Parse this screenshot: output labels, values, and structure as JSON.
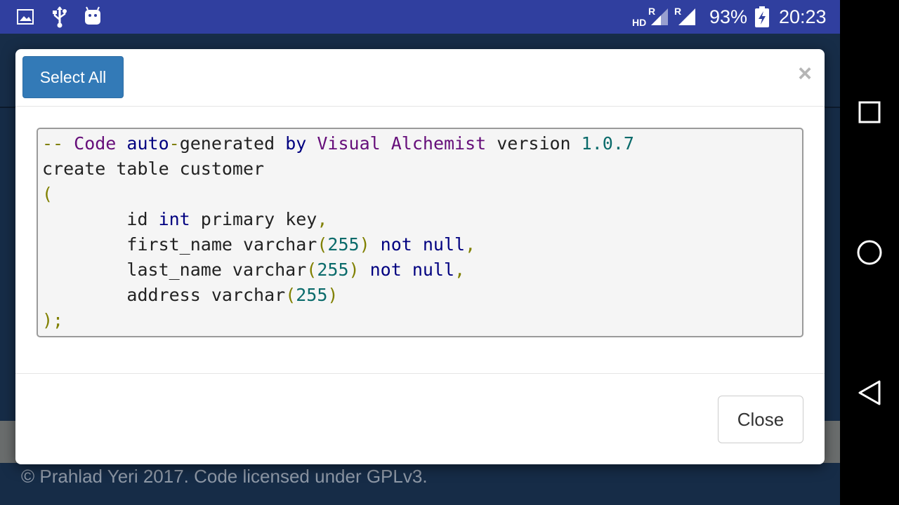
{
  "status_bar": {
    "battery_percent": "93%",
    "time": "20:23",
    "hd_label": "HD",
    "roaming_label_1": "R",
    "roaming_label_2": "R",
    "icons": [
      "image-icon",
      "usb-icon",
      "android-debug-icon",
      "signal-icon",
      "battery-charging-icon"
    ]
  },
  "dialog": {
    "select_all_label": "Select All",
    "close_x": "×",
    "close_button_label": "Close",
    "code_lines": [
      [
        {
          "t": "-- ",
          "c": "punct"
        },
        {
          "t": "Code ",
          "c": "cm"
        },
        {
          "t": "auto",
          "c": "kw"
        },
        {
          "t": "-",
          "c": "punct"
        },
        {
          "t": "generated ",
          "c": "plain"
        },
        {
          "t": "by ",
          "c": "kw"
        },
        {
          "t": "Visual Alchemist ",
          "c": "cm"
        },
        {
          "t": "version ",
          "c": "plain"
        },
        {
          "t": "1.0.7",
          "c": "num"
        }
      ],
      [
        {
          "t": "create table customer",
          "c": "plain"
        }
      ],
      [
        {
          "t": "(",
          "c": "punct"
        }
      ],
      [
        {
          "t": "        id ",
          "c": "plain"
        },
        {
          "t": "int ",
          "c": "kw"
        },
        {
          "t": "primary key",
          "c": "plain"
        },
        {
          "t": ",",
          "c": "punct"
        }
      ],
      [
        {
          "t": "        first_name varchar",
          "c": "plain"
        },
        {
          "t": "(",
          "c": "punct"
        },
        {
          "t": "255",
          "c": "num"
        },
        {
          "t": ") ",
          "c": "punct"
        },
        {
          "t": "not null",
          "c": "kw"
        },
        {
          "t": ",",
          "c": "punct"
        }
      ],
      [
        {
          "t": "        last_name varchar",
          "c": "plain"
        },
        {
          "t": "(",
          "c": "punct"
        },
        {
          "t": "255",
          "c": "num"
        },
        {
          "t": ") ",
          "c": "punct"
        },
        {
          "t": "not null",
          "c": "kw"
        },
        {
          "t": ",",
          "c": "punct"
        }
      ],
      [
        {
          "t": "        address varchar",
          "c": "plain"
        },
        {
          "t": "(",
          "c": "punct"
        },
        {
          "t": "255",
          "c": "num"
        },
        {
          "t": ")",
          "c": "punct"
        }
      ],
      [
        {
          "t": ");",
          "c": "punct"
        }
      ]
    ]
  },
  "footer": {
    "text": "© Prahlad Yeri 2017. Code licensed under GPLv3."
  },
  "nav_bar": {
    "icons": [
      "recents-square-icon",
      "home-circle-icon",
      "back-triangle-icon"
    ]
  },
  "colors": {
    "status_bar_bg": "#303f9f",
    "primary_button": "#337ab7",
    "app_background": "#162c47"
  }
}
